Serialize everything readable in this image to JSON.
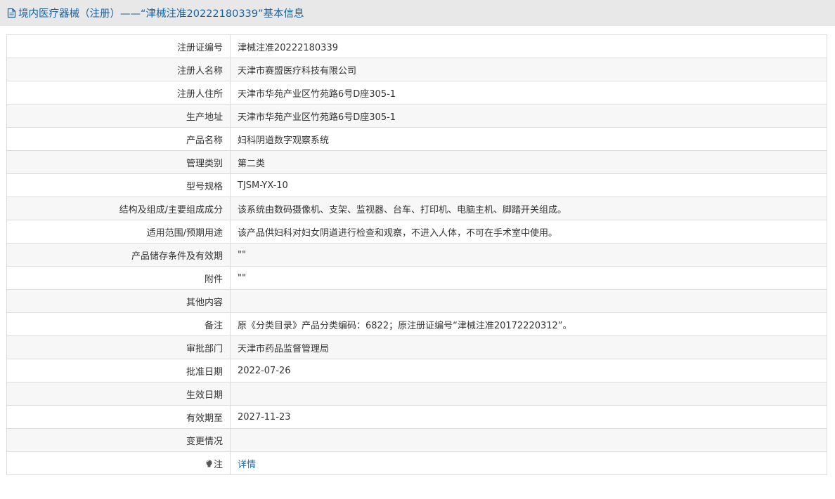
{
  "header": {
    "title": "境内医疗器械（注册）——“津械注准20222180339”基本信息",
    "icon": "document-icon",
    "color": "#1a5f9e"
  },
  "rows": [
    {
      "label": "注册证编号",
      "value": "津械注准20222180339"
    },
    {
      "label": "注册人名称",
      "value": "天津市赛盟医疗科技有限公司"
    },
    {
      "label": "注册人住所",
      "value": "天津市华苑产业区竹苑路6号D座305-1"
    },
    {
      "label": "生产地址",
      "value": "天津市华苑产业区竹苑路6号D座305-1"
    },
    {
      "label": "产品名称",
      "value": "妇科阴道数字观察系统"
    },
    {
      "label": "管理类别",
      "value": "第二类"
    },
    {
      "label": "型号规格",
      "value": "TJSM-YX-10"
    },
    {
      "label": "结构及组成/主要组成成分",
      "value": "该系统由数码摄像机、支架、监视器、台车、打印机、电脑主机、脚踏开关组成。"
    },
    {
      "label": "适用范围/预期用途",
      "value": "该产品供妇科对妇女阴道进行检查和观察，不进入人体，不可在手术室中使用。"
    },
    {
      "label": "产品储存条件及有效期",
      "value": "\"\""
    },
    {
      "label": "附件",
      "value": "\"\""
    },
    {
      "label": "其他内容",
      "value": ""
    },
    {
      "label": "备注",
      "value": "原《分类目录》产品分类编码：6822；原注册证编号“津械注准20172220312”。"
    },
    {
      "label": "审批部门",
      "value": "天津市药品监督管理局"
    },
    {
      "label": "批准日期",
      "value": "2022-07-26"
    },
    {
      "label": "生效日期",
      "value": ""
    },
    {
      "label": "有效期至",
      "value": "2027-11-23"
    },
    {
      "label": "变更情况",
      "value": ""
    }
  ],
  "note_row": {
    "label": "注",
    "icon": "lightbulb-icon",
    "link": "详情",
    "link_color": "#1a6ab8"
  }
}
